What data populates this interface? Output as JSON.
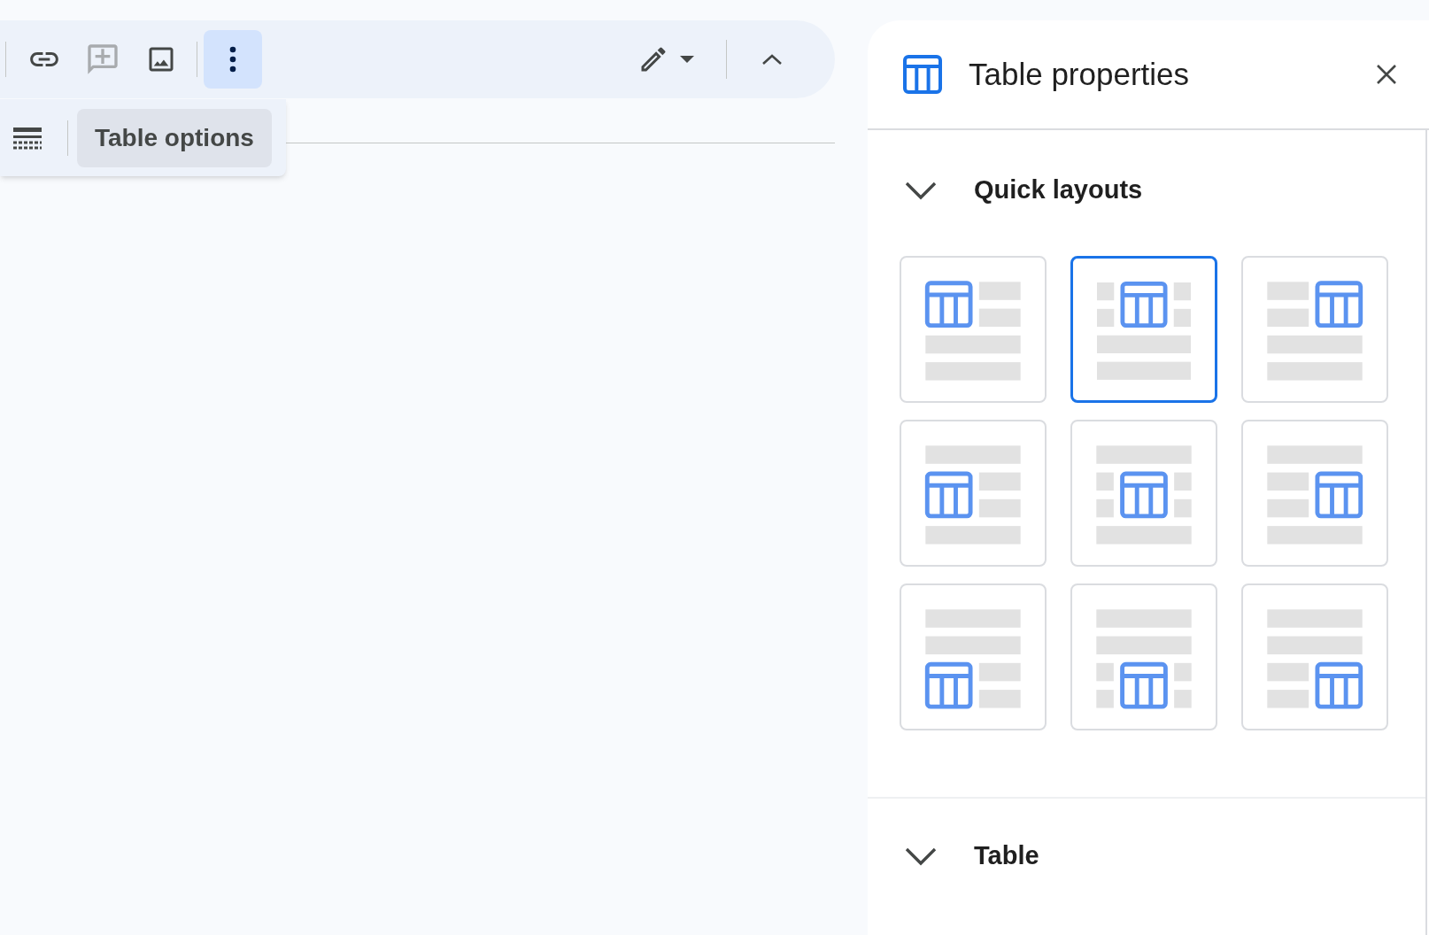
{
  "toolbar": {
    "buttons": [
      {
        "kind": "link",
        "disabled": false,
        "selected": false
      },
      {
        "kind": "comment",
        "disabled": true,
        "selected": false
      },
      {
        "kind": "image",
        "disabled": false,
        "selected": false
      },
      {
        "kind": "more",
        "disabled": false,
        "selected": true
      },
      {
        "kind": "pencil",
        "disabled": false,
        "selected": false
      },
      {
        "kind": "collapse",
        "disabled": false,
        "selected": false
      }
    ]
  },
  "popup": {
    "button": "Table options"
  },
  "panel": {
    "title": "Table properties",
    "sections": [
      {
        "title": "Quick layouts",
        "expanded": true,
        "layouts": [
          {
            "kind": "top-left",
            "selected": false
          },
          {
            "kind": "top-center",
            "selected": true
          },
          {
            "kind": "top-right",
            "selected": false
          },
          {
            "kind": "middle-left",
            "selected": false
          },
          {
            "kind": "middle-center",
            "selected": false
          },
          {
            "kind": "middle-right",
            "selected": false
          },
          {
            "kind": "bottom-left",
            "selected": false
          },
          {
            "kind": "bottom-center",
            "selected": false
          },
          {
            "kind": "bottom-right",
            "selected": false
          }
        ]
      },
      {
        "title": "Table",
        "expanded": true
      }
    ]
  }
}
